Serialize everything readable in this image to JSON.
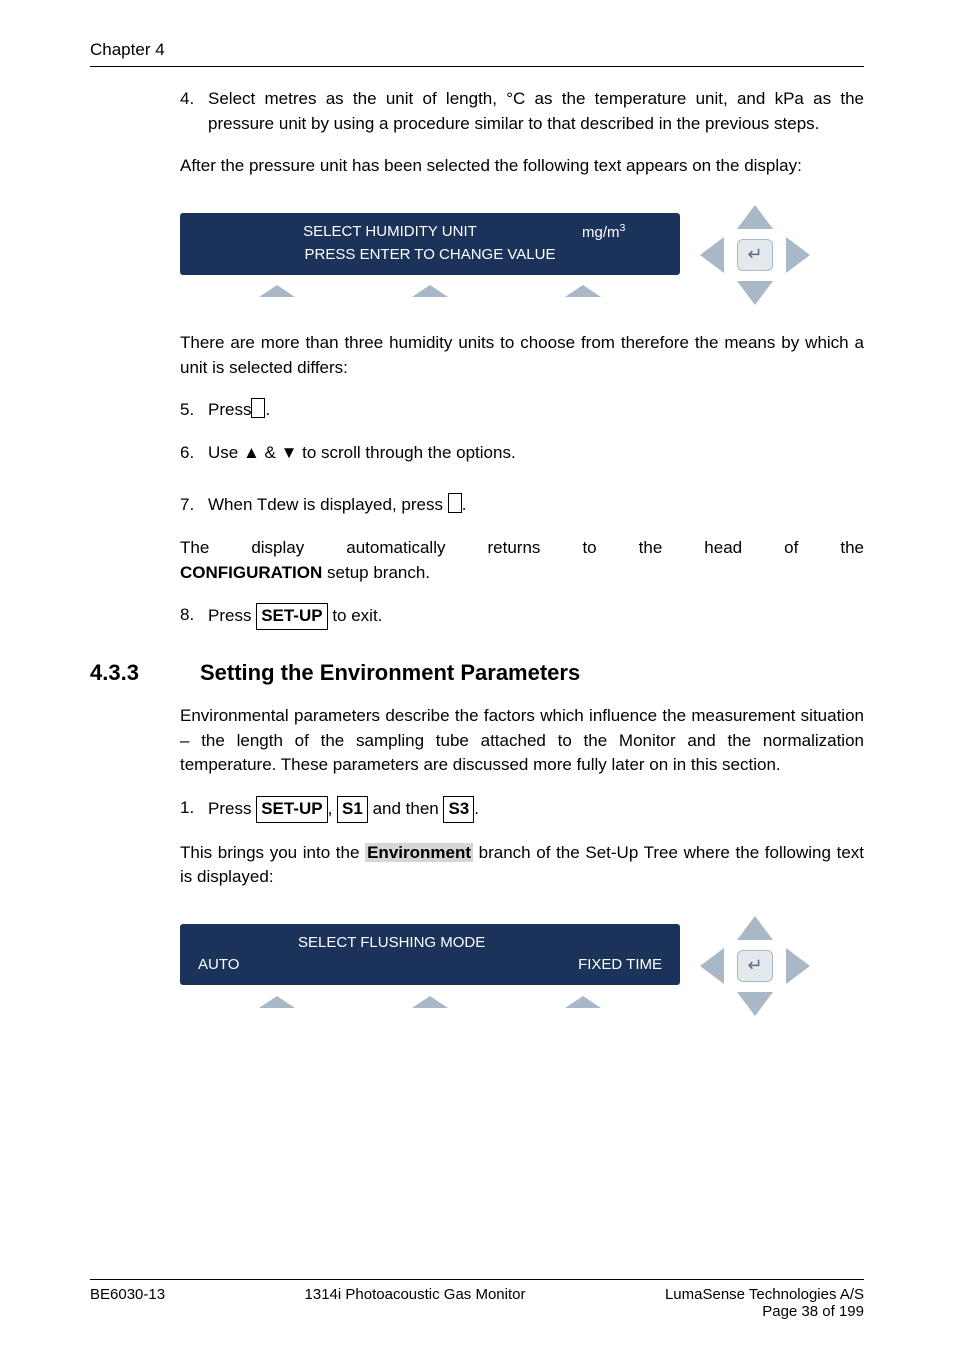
{
  "header": {
    "chapter": "Chapter 4"
  },
  "item4": {
    "num": "4.",
    "text": "Select metres as the unit of length, °C as the temperature unit, and kPa as the pressure unit by using a procedure similar to that described in the previous steps."
  },
  "para_after4": "After the pressure unit has been selected the following text appears on the display:",
  "lcd1": {
    "line1_label": "SELECT HUMIDITY UNIT",
    "line1_val": "mg/m",
    "line1_sup": "3",
    "line2": "PRESS ENTER TO CHANGE VALUE"
  },
  "para_after_lcd1": "There are more than three humidity units to choose from therefore the means by which a unit is selected differs:",
  "item5": {
    "num": "5.",
    "text": "Press"
  },
  "item6": {
    "num": "6.",
    "text": "Use ▲ & ▼ to scroll through the options."
  },
  "item7": {
    "num": "7.",
    "text": "When Tdew is displayed, press "
  },
  "para_config_a": "The display automatically returns to the head of the ",
  "para_config_bold": "CONFIGURATION",
  "para_config_b": " setup branch.",
  "item8": {
    "num": "8.",
    "text_a": "Press ",
    "key": "SET-UP",
    "text_b": " to exit."
  },
  "section": {
    "num": "4.3.3",
    "title": "Setting the Environment Parameters"
  },
  "env_para": "Environmental parameters describe the factors which influence the measurement situation – the length of the sampling tube attached to the Monitor and the normalization temperature. These parameters are discussed more fully later on in this section.",
  "item1b": {
    "num": "1.",
    "text_a": "Press ",
    "key1": "SET-UP",
    "sep1": ", ",
    "key2": "S1",
    "sep2": " and then ",
    "key3": "S3",
    "tail": "."
  },
  "env_para2_a": "This brings you into the ",
  "env_para2_hl": "Environment",
  "env_para2_b": " branch of the Set-Up Tree where the following text is displayed:",
  "lcd2": {
    "line1": "SELECT FLUSHING MODE",
    "opt_left": "AUTO",
    "opt_right": "FIXED TIME"
  },
  "footer": {
    "left": "BE6030-13",
    "center": "1314i Photoacoustic Gas Monitor",
    "right1": "LumaSense Technologies A/S",
    "right2": "Page 38 of 199"
  }
}
